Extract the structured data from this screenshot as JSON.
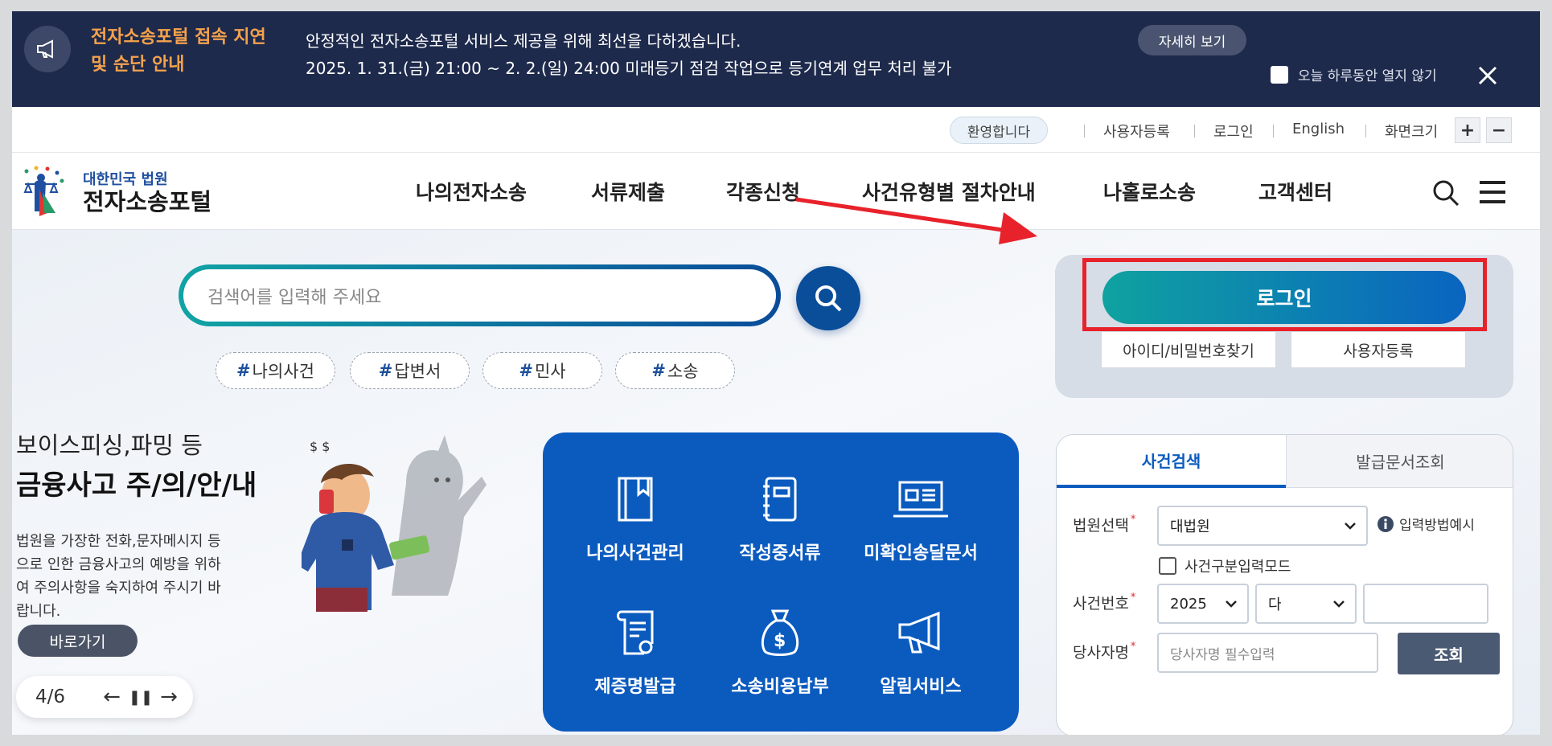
{
  "notice": {
    "title_line1": "전자소송포털 접속 지연",
    "title_line2": "및 순단 안내",
    "text_line1": "안정적인 전자소송포털 서비스 제공을 위해 최선을 다하겠습니다.",
    "text_line2": "2025. 1. 31.(금) 21:00 ~ 2. 2.(일) 24:00 미래등기 점검 작업으로 등기연계 업무 처리 불가",
    "more_label": "자세히 보기",
    "dont_open_label": "오늘 하루동안 열지 않기",
    "close_icon": "close-icon"
  },
  "util": {
    "welcome": "환영합니다",
    "register": "사용자등록",
    "login": "로그인",
    "english": "English",
    "font_size": "화면크기",
    "plus": "+",
    "minus": "−"
  },
  "header": {
    "logo_top": "대한민국 법원",
    "logo_bottom": "전자소송포털",
    "nav": [
      "나의전자소송",
      "서류제출",
      "각종신청",
      "사건유형별 절차안내",
      "나홀로소송",
      "고객센터"
    ]
  },
  "search": {
    "placeholder": "검색어를 입력해 주세요",
    "tags": [
      "나의사건",
      "답변서",
      "민사",
      "소송"
    ]
  },
  "banner": {
    "line1": "보이스피싱,파밍 등",
    "line2": "금융사고 주/의/안/내",
    "desc": "법원을 가장한 전화,문자메시지 등으로 인한 금융사고의 예방을 위하여 주의사항을 숙지하여 주시기 바랍니다.",
    "go_label": "바로가기",
    "page": "4/6"
  },
  "quick_menu": [
    {
      "label": "나의사건관리",
      "icon": "book-icon"
    },
    {
      "label": "작성중서류",
      "icon": "notebook-icon"
    },
    {
      "label": "미확인송달문서",
      "icon": "laptop-icon"
    },
    {
      "label": "제증명발급",
      "icon": "certificate-icon"
    },
    {
      "label": "소송비용납부",
      "icon": "money-bag-icon"
    },
    {
      "label": "알림서비스",
      "icon": "megaphone-icon"
    }
  ],
  "login": {
    "login_label": "로그인",
    "find_label": "아이디/비밀번호찾기",
    "register_label": "사용자등록"
  },
  "case_search": {
    "tab_active": "사건검색",
    "tab_other": "발급문서조회",
    "court_label": "법원선택",
    "court_value": "대법원",
    "input_help": "입력방법예시",
    "mode_label": "사건구분입력모드",
    "case_no_label": "사건번호",
    "year_value": "2025",
    "type_value": "다",
    "number_value": "",
    "party_label": "당사자명",
    "party_placeholder": "당사자명 필수입력",
    "search_label": "조회",
    "required_mark": "*"
  },
  "colors": {
    "notice_bg": "#1e2a4c",
    "notice_title": "#f5a24c",
    "quick_bg": "#0b5bbf",
    "highlight": "#e8222b"
  }
}
